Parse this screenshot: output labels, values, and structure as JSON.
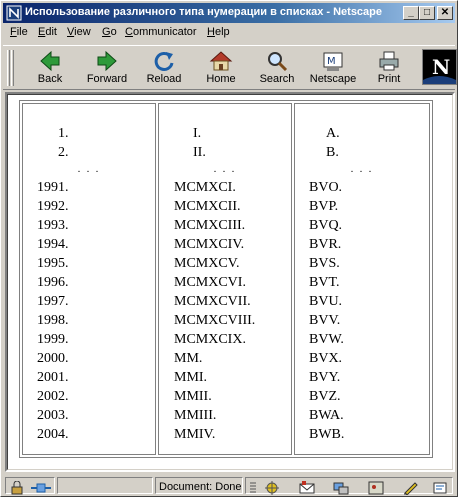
{
  "window": {
    "title": "Использование различного типа нумерации в списках - Netscape",
    "min_label": "_",
    "max_label": "□",
    "close_label": "✕"
  },
  "menu": [
    {
      "label": "File"
    },
    {
      "label": "Edit"
    },
    {
      "label": "View"
    },
    {
      "label": "Go"
    },
    {
      "label": "Communicator"
    },
    {
      "label": "Help"
    }
  ],
  "toolbar": {
    "back": "Back",
    "forward": "Forward",
    "reload": "Reload",
    "home": "Home",
    "search": "Search",
    "netscape": "Netscape",
    "print": "Print",
    "logo_letter": "N"
  },
  "lists": {
    "arabic_head": [
      "1.",
      "2."
    ],
    "roman_head": [
      "I.",
      "II."
    ],
    "alpha_head": [
      "A.",
      "B."
    ],
    "ellipsis": ". . .",
    "arabic": [
      "1991.",
      "1992.",
      "1993.",
      "1994.",
      "1995.",
      "1996.",
      "1997.",
      "1998.",
      "1999.",
      "2000.",
      "2001.",
      "2002.",
      "2003.",
      "2004."
    ],
    "roman": [
      "MCMXCI.",
      "MCMXCII.",
      "MCMXCIII.",
      "MCMXCIV.",
      "MCMXCV.",
      "MCMXCVI.",
      "MCMXCVII.",
      "MCMXCVIII.",
      "MCMXCIX.",
      "MM.",
      "MMI.",
      "MMII.",
      "MMIII.",
      "MMIV."
    ],
    "alpha": [
      "BVO.",
      "BVP.",
      "BVQ.",
      "BVR.",
      "BVS.",
      "BVT.",
      "BVU.",
      "BVV.",
      "BVW.",
      "BVX.",
      "BVY.",
      "BVZ.",
      "BWA.",
      "BWB."
    ]
  },
  "status": {
    "text": "Document: Done"
  }
}
